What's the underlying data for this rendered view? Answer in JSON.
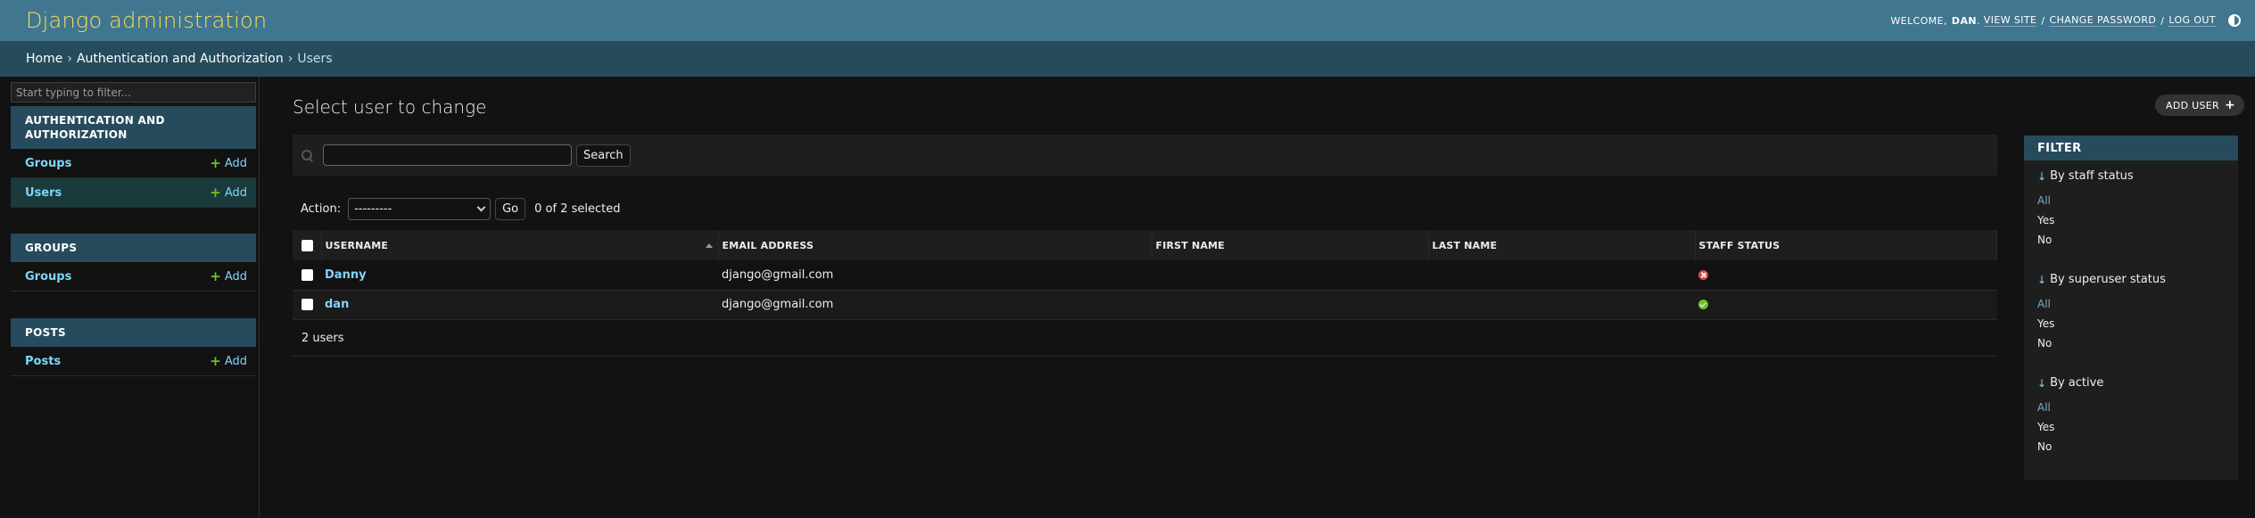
{
  "header": {
    "site_name": "Django administration",
    "welcome": "WELCOME,",
    "user": "DAN",
    "view_site": "VIEW SITE",
    "change_password": "CHANGE PASSWORD",
    "log_out": "LOG OUT",
    "sep": "/"
  },
  "breadcrumbs": {
    "home": "Home",
    "app": "Authentication and Authorization",
    "current": "Users",
    "sep": "›"
  },
  "sidebar": {
    "filter_placeholder": "Start typing to filter...",
    "modules": [
      {
        "caption": "AUTHENTICATION AND AUTHORIZATION",
        "rows": [
          {
            "label": "Groups",
            "add": "Add"
          },
          {
            "label": "Users",
            "add": "Add"
          }
        ]
      },
      {
        "caption": "GROUPS",
        "rows": [
          {
            "label": "Groups",
            "add": "Add"
          }
        ]
      },
      {
        "caption": "POSTS",
        "rows": [
          {
            "label": "Posts",
            "add": "Add"
          }
        ]
      }
    ]
  },
  "content": {
    "title": "Select user to change",
    "add_button": "ADD USER",
    "search_button": "Search",
    "search_value": "",
    "action_label": "Action:",
    "action_selected": "---------",
    "go_button": "Go",
    "counter": "0 of 2 selected",
    "columns": [
      "USERNAME",
      "EMAIL ADDRESS",
      "FIRST NAME",
      "LAST NAME",
      "STAFF STATUS"
    ],
    "rows": [
      {
        "username": "Danny",
        "email": "django@gmail.com",
        "first_name": "",
        "last_name": "",
        "staff": "no"
      },
      {
        "username": "dan",
        "email": "django@gmail.com",
        "first_name": "",
        "last_name": "",
        "staff": "yes"
      }
    ],
    "paginator": "2 users"
  },
  "filter": {
    "heading": "FILTER",
    "groups": [
      {
        "title": "By staff status",
        "options": [
          "All",
          "Yes",
          "No"
        ]
      },
      {
        "title": "By superuser status",
        "options": [
          "All",
          "Yes",
          "No"
        ]
      },
      {
        "title": "By active",
        "options": [
          "All",
          "Yes",
          "No"
        ]
      }
    ]
  },
  "colors": {
    "header": "#417690",
    "breadcrumbs": "#264b5d",
    "site_name": "#f5dd5d",
    "link": "#81d4fa",
    "add_green": "#70bf2b",
    "no_red": "#dd4646"
  }
}
